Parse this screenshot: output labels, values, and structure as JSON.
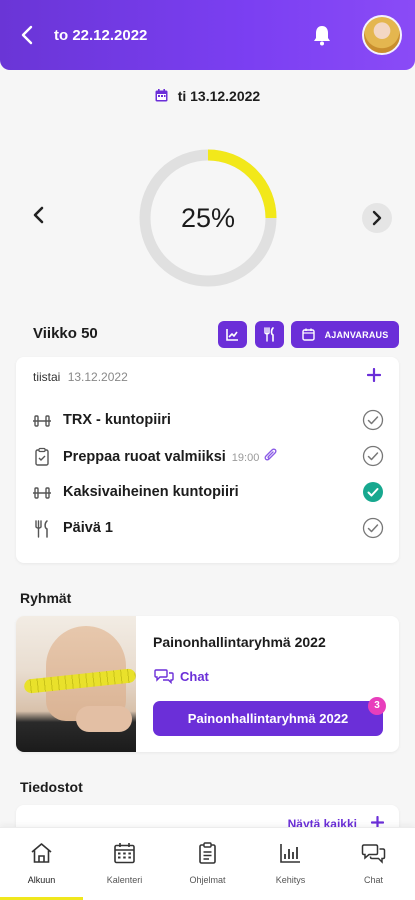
{
  "header": {
    "title": "to 22.12.2022",
    "back_icon": "chevron-left-icon",
    "bell_icon": "bell-icon"
  },
  "date_row": {
    "label": "ti 13.12.2022"
  },
  "progress": {
    "label": "25%",
    "value": 0.25,
    "track_color": "#e0e0e0",
    "fill_color": "#f2e81a"
  },
  "week": {
    "title": "Viikko 50",
    "booking_label": "AJANVARAUS"
  },
  "day": {
    "weekday": "tiistai",
    "date": "13.12.2022",
    "tasks": [
      {
        "label": "TRX - kuntopiiri",
        "time": "",
        "icon": "dumbbell-icon",
        "done": false
      },
      {
        "label": "Preppaa ruoat valmiiksi",
        "time": "19:00",
        "icon": "clipboard-icon",
        "done": false,
        "attachment": true
      },
      {
        "label": "Kaksivaiheinen kuntopiiri",
        "time": "",
        "icon": "dumbbell-icon",
        "done": true
      },
      {
        "label": "Päivä 1",
        "time": "",
        "icon": "fork-knife-icon",
        "done": false
      }
    ]
  },
  "groups": {
    "title": "Ryhmät",
    "name": "Painonhallintaryhmä 2022",
    "chat_label": "Chat",
    "button_label": "Painonhallintaryhmä 2022",
    "badge": "3"
  },
  "files": {
    "title": "Tiedostot",
    "show_all": "Näytä kaikki"
  },
  "tabs": [
    {
      "label": "Alkuun",
      "icon": "home-icon",
      "active": true
    },
    {
      "label": "Kalenteri",
      "icon": "calendar-icon",
      "active": false
    },
    {
      "label": "Ohjelmat",
      "icon": "clipboard-icon",
      "active": false
    },
    {
      "label": "Kehitys",
      "icon": "bar-chart-icon",
      "active": false
    },
    {
      "label": "Chat",
      "icon": "chat-bubbles-icon",
      "active": false
    }
  ],
  "colors": {
    "accent": "#6b2fd8",
    "done": "#17a88f",
    "highlight": "#f0e71c",
    "badge": "#e83ebc"
  }
}
